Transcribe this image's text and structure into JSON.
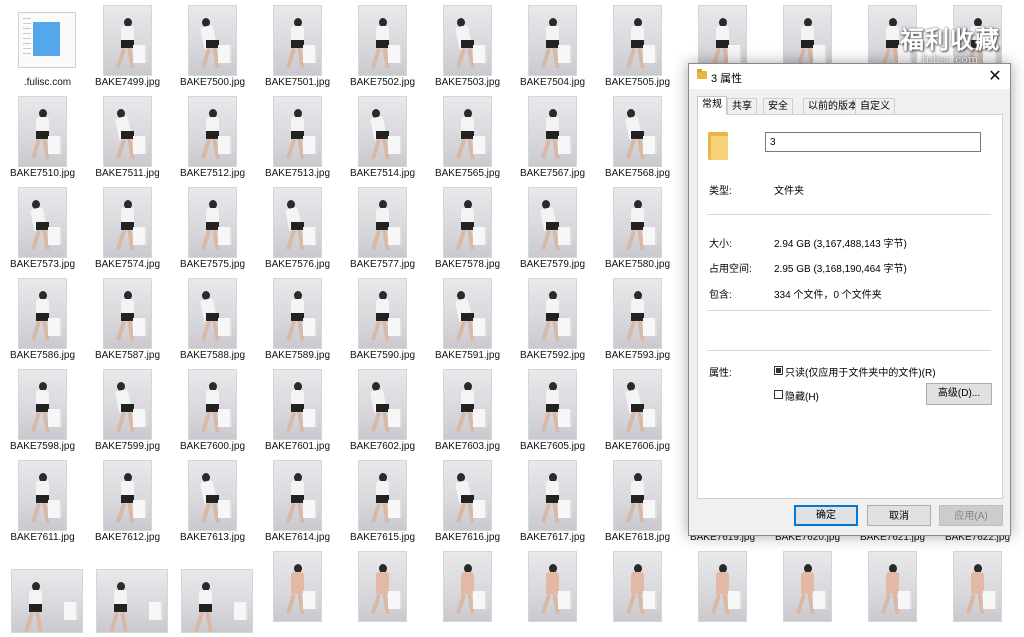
{
  "explorer": {
    "folder_name": ".fulisc.com",
    "row1": [
      "BAKE7499.jpg",
      "BAKE7500.jpg",
      "BAKE7501.jpg",
      "BAKE7502.jpg",
      "BAKE7503.jpg",
      "BAKE7504.jpg",
      "BAKE7505.jpg"
    ],
    "row2": [
      "BAKE7510.jpg",
      "BAKE7511.jpg",
      "BAKE7512.jpg",
      "BAKE7513.jpg",
      "BAKE7514.jpg",
      "BAKE7565.jpg",
      "BAKE7567.jpg",
      "BAKE7568.jpg"
    ],
    "row3": [
      "BAKE7573.jpg",
      "BAKE7574.jpg",
      "BAKE7575.jpg",
      "BAKE7576.jpg",
      "BAKE7577.jpg",
      "BAKE7578.jpg",
      "BAKE7579.jpg",
      "BAKE7580.jpg"
    ],
    "row4": [
      "BAKE7586.jpg",
      "BAKE7587.jpg",
      "BAKE7588.jpg",
      "BAKE7589.jpg",
      "BAKE7590.jpg",
      "BAKE7591.jpg",
      "BAKE7592.jpg",
      "BAKE7593.jpg"
    ],
    "row5": [
      "BAKE7598.jpg",
      "BAKE7599.jpg",
      "BAKE7600.jpg",
      "BAKE7601.jpg",
      "BAKE7602.jpg",
      "BAKE7603.jpg",
      "BAKE7605.jpg",
      "BAKE7606.jpg"
    ],
    "row6": [
      "BAKE7611.jpg",
      "BAKE7612.jpg",
      "BAKE7613.jpg",
      "BAKE7614.jpg",
      "BAKE7615.jpg",
      "BAKE7616.jpg",
      "BAKE7617.jpg",
      "BAKE7618.jpg",
      "BAKE7619.jpg",
      "BAKE7620.jpg",
      "BAKE7621.jpg",
      "BAKE7622.jpg"
    ]
  },
  "watermark": {
    "big": "福利收藏",
    "small": "fulisc.com"
  },
  "dialog": {
    "title": "3 属性",
    "close_icon": "close-icon",
    "tabs": [
      "常规",
      "共享",
      "安全",
      "以前的版本",
      "自定义"
    ],
    "active_tab": "常规",
    "name_value": "3",
    "type_label": "类型:",
    "type_value": "文件夹",
    "size_label": "大小:",
    "size_value": "2.94 GB (3,167,488,143 字节)",
    "disk_label": "占用空间:",
    "disk_value": "2.95 GB (3,168,190,464 字节)",
    "contains_label": "包含:",
    "contains_value": "334 个文件，0 个文件夹",
    "attr_label": "属性:",
    "readonly_label": "只读(仅应用于文件夹中的文件)(R)",
    "hidden_label": "隐藏(H)",
    "advanced_button": "高级(D)...",
    "ok_button": "确定",
    "cancel_button": "取消",
    "apply_button": "应用(A)",
    "colors": {
      "accent": "#0078d7",
      "folder": "#e9b545"
    }
  }
}
